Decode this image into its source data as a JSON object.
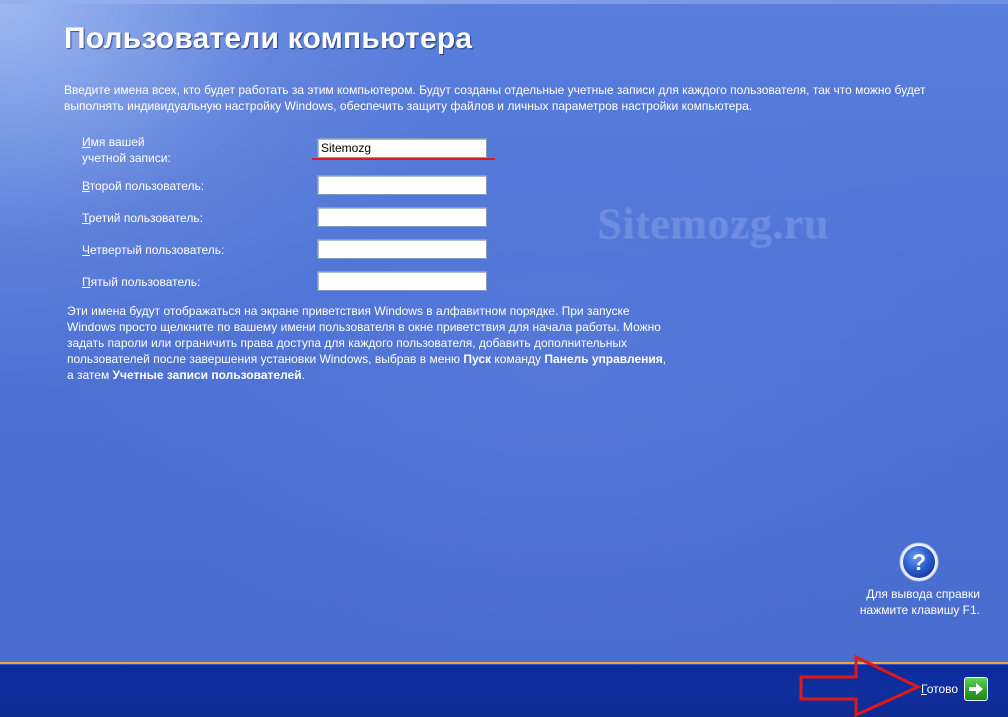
{
  "page": {
    "title": "Пользователи компьютера",
    "intro": "Введите имена всех, кто будет работать за этим компьютером. Будут созданы отдельные учетные записи для каждого пользователя, так что можно будет выполнять индивидуальную настройку Windows, обеспечить защиту файлов и личных параметров настройки компьютера.",
    "watermark": "Sitemozg.ru"
  },
  "form": {
    "fields": [
      {
        "label_first": "И",
        "label_rest": "мя вашей",
        "label_line2": "учетной записи:",
        "value": "Sitemozg"
      },
      {
        "label_first": "В",
        "label_rest": "торой пользователь:",
        "value": ""
      },
      {
        "label_first": "Т",
        "label_rest": "ретий пользователь:",
        "value": ""
      },
      {
        "label_first": "Ч",
        "label_rest": "етвертый пользователь:",
        "value": ""
      },
      {
        "label_first": "П",
        "label_rest": "ятый пользователь:",
        "value": ""
      }
    ]
  },
  "help_text": {
    "part1": "Эти имена будут отображаться на экране приветствия Windows в алфавитном порядке. При запуске Windows просто щелкните по вашему имени пользователя в окне приветствия для начала работы. Можно задать пароли или ограничить права доступа для каждого пользователя, добавить дополнительных пользователей после завершения установки Windows, выбрав в меню ",
    "bold1": "Пуск",
    "part2": " команду ",
    "bold2": "Панель управления",
    "part3": ", а затем ",
    "bold3": "Учетные записи пользователей",
    "part4": "."
  },
  "help_hint": {
    "line1": "Для вывода справки",
    "line2": "нажмите клавишу F1.",
    "icon": "question-icon"
  },
  "footer": {
    "done_first": "Г",
    "done_rest": "отово",
    "done_icon": "arrow-right-icon"
  },
  "colors": {
    "background": "#4f74d6",
    "bottom_bar": "#102f9e",
    "accent_orange": "#f2a33a",
    "annotation_red": "#e01818",
    "done_green": "#2fa52b"
  }
}
